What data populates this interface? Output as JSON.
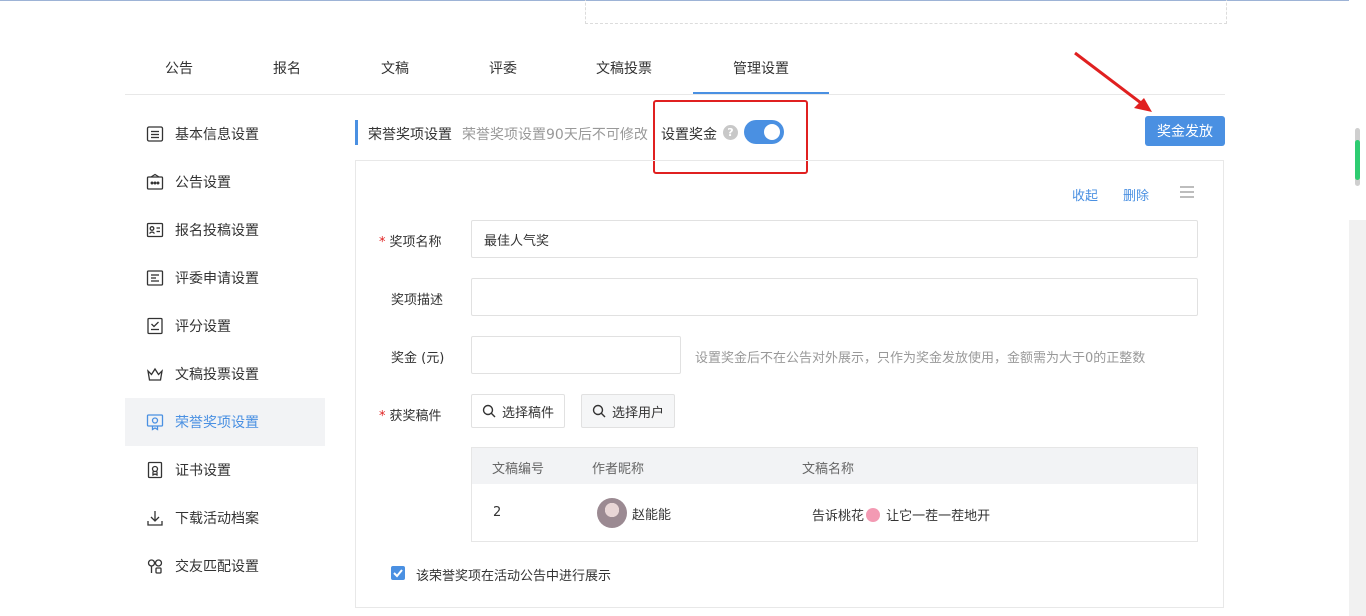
{
  "tabs": [
    {
      "label": "公告"
    },
    {
      "label": "报名"
    },
    {
      "label": "文稿"
    },
    {
      "label": "评委"
    },
    {
      "label": "文稿投票"
    },
    {
      "label": "管理设置"
    }
  ],
  "sidebar": {
    "items": [
      {
        "label": "基本信息设置",
        "icon": "list-icon"
      },
      {
        "label": "公告设置",
        "icon": "announcement-icon"
      },
      {
        "label": "报名投稿设置",
        "icon": "id-card-icon"
      },
      {
        "label": "评委申请设置",
        "icon": "application-icon"
      },
      {
        "label": "评分设置",
        "icon": "checklist-icon"
      },
      {
        "label": "文稿投票设置",
        "icon": "crown-icon"
      },
      {
        "label": "荣誉奖项设置",
        "icon": "award-icon"
      },
      {
        "label": "证书设置",
        "icon": "certificate-icon"
      },
      {
        "label": "下载活动档案",
        "icon": "download-icon"
      },
      {
        "label": "交友匹配设置",
        "icon": "match-icon"
      }
    ]
  },
  "header": {
    "title": "荣誉奖项设置",
    "note": "荣誉奖项设置90天后不可修改",
    "bonus_label": "设置奖金",
    "help": "?",
    "bonus_button": "奖金发放"
  },
  "panel": {
    "collapse": "收起",
    "delete": "删除"
  },
  "form": {
    "name_label": "奖项名称",
    "name_value": "最佳人气奖",
    "desc_label": "奖项描述",
    "amount_label": "奖金 (元)",
    "amount_hint": "设置奖金后不在公告对外展示，只作为奖金发放使用，金额需为大于0的正整数",
    "works_label": "获奖稿件",
    "select_works": "选择稿件",
    "select_users": "选择用户",
    "required_mark": "*"
  },
  "table": {
    "headers": [
      "文稿编号",
      "作者昵称",
      "文稿名称"
    ],
    "rows": [
      {
        "id": "2",
        "author": "赵能能",
        "title_a": "告诉桃花",
        "title_b": "让它一茬一茬地开"
      }
    ]
  },
  "footer": {
    "checkbox_label": "该荣誉奖项在活动公告中进行展示"
  },
  "colors": {
    "accent": "#4a90e2",
    "highlight": "#e02020"
  }
}
